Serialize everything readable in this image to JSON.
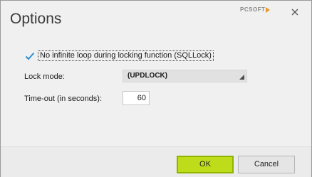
{
  "window": {
    "title": "Options",
    "brand": "PCSOFT"
  },
  "icons": {
    "close": "close-icon",
    "check": "checkmark-icon",
    "dropdown": "dropdown-arrow-icon"
  },
  "options": {
    "no_loop_label": "No infinite loop during locking function (SQLLock)",
    "no_loop_checked": true,
    "lock_mode_label": "Lock mode:",
    "lock_mode_value": "(UPDLOCK)",
    "timeout_label": "Time-out (in seconds):",
    "timeout_value": "60"
  },
  "buttons": {
    "ok": "OK",
    "cancel": "Cancel"
  },
  "colors": {
    "ok_fill": "#bfdc1a",
    "check": "#2b8fd6"
  }
}
